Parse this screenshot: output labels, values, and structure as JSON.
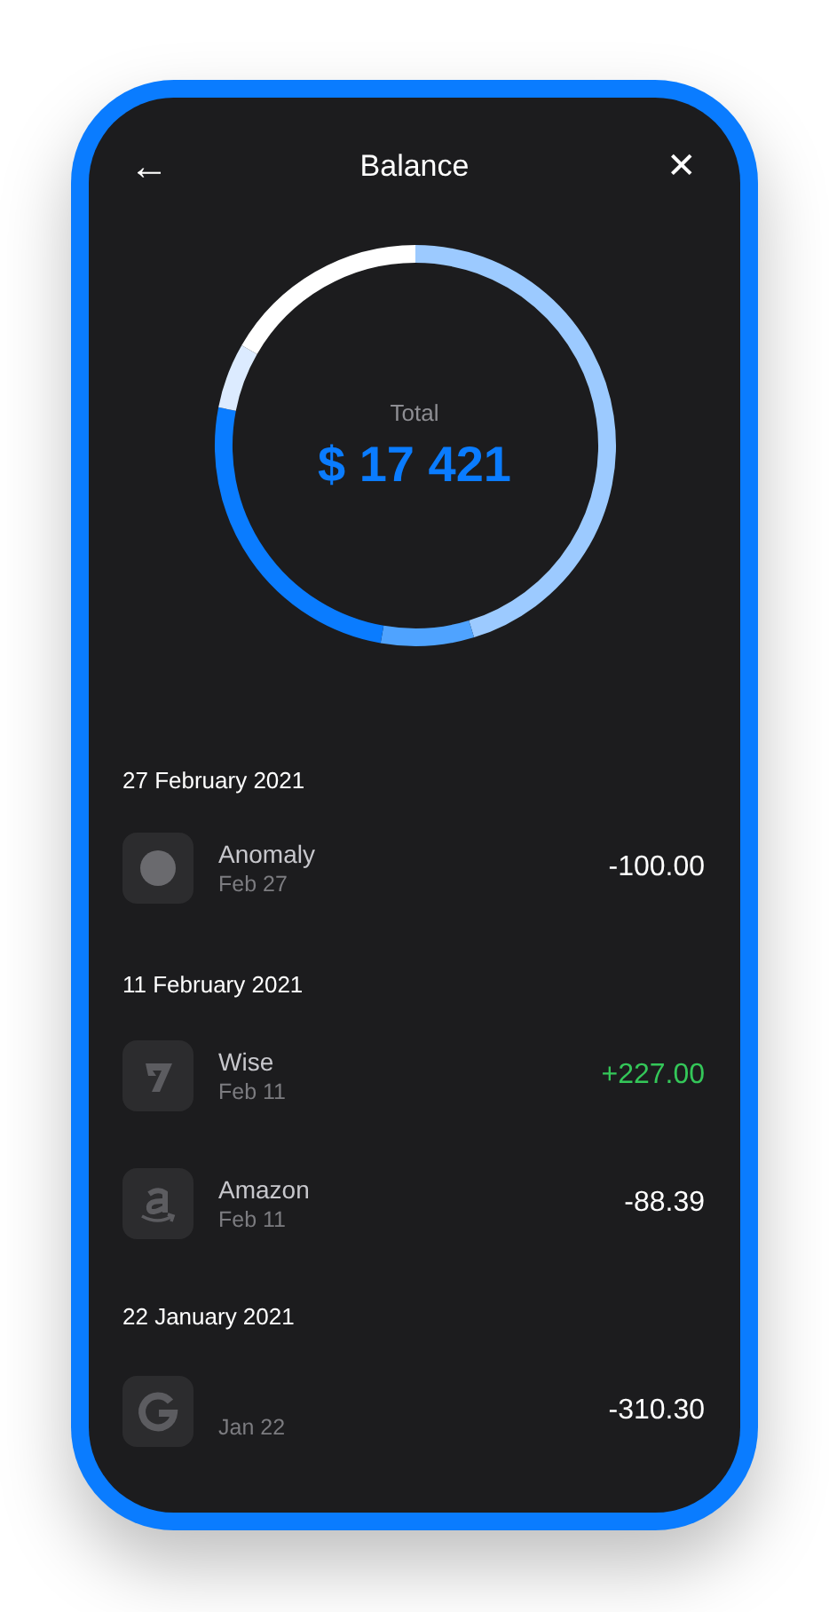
{
  "header": {
    "back": "←",
    "title": "Balance",
    "close": "✕"
  },
  "total": {
    "label": "Total",
    "amount": "$ 17 421"
  },
  "sections": [
    {
      "date": "27 February 2021",
      "transactions": [
        {
          "kind": "dot",
          "name": "Anomaly",
          "date": "Feb 27",
          "amount": "-100.00",
          "income": false
        }
      ]
    },
    {
      "date": "11 February 2021",
      "transactions": [
        {
          "kind": "wise",
          "name": "Wise",
          "date": "Feb 11",
          "amount": "+227.00",
          "income": true
        },
        {
          "kind": "amazon",
          "name": "Amazon",
          "date": "Feb 11",
          "amount": "-88.39",
          "income": false
        }
      ]
    },
    {
      "date": "22 January 2021",
      "transactions": [
        {
          "kind": "google",
          "date": "Jan 22",
          "amount": "-310.30",
          "income": false
        }
      ]
    }
  ]
}
